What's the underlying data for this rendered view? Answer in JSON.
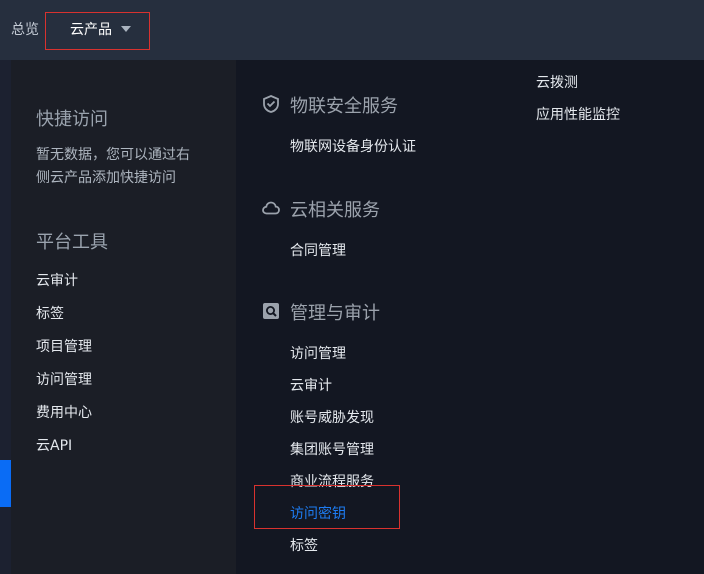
{
  "header": {
    "overview": "总览",
    "products": "云产品"
  },
  "sidebar": {
    "quick_access_title": "快捷访问",
    "quick_access_empty_line1": "暂无数据，您可以通过右",
    "quick_access_empty_line2": "侧云产品添加快捷访问",
    "tools_title": "平台工具",
    "tools": [
      "云审计",
      "标签",
      "项目管理",
      "访问管理",
      "费用中心",
      "云API"
    ]
  },
  "groups": {
    "iot_security": {
      "title": "物联安全服务",
      "items": [
        "物联网设备身份认证"
      ]
    },
    "cloud_related": {
      "title": "云相关服务",
      "items": [
        "合同管理"
      ]
    },
    "mgmt_audit": {
      "title": "管理与审计",
      "items": [
        "访问管理",
        "云审计",
        "账号威胁发现",
        "集团账号管理",
        "商业流程服务",
        "访问密钥",
        "标签"
      ]
    }
  },
  "right_col": {
    "items": [
      "云拨测",
      "应用性能监控"
    ]
  },
  "colors": {
    "active": "#1e7cf2",
    "highlight_box": "#d8322f",
    "accent_bar": "#0a6cf5"
  },
  "icons": {
    "iot_security": "shield-check-icon",
    "cloud_related": "cloud-icon",
    "mgmt_audit": "search-box-icon",
    "dropdown": "caret-down-icon"
  }
}
